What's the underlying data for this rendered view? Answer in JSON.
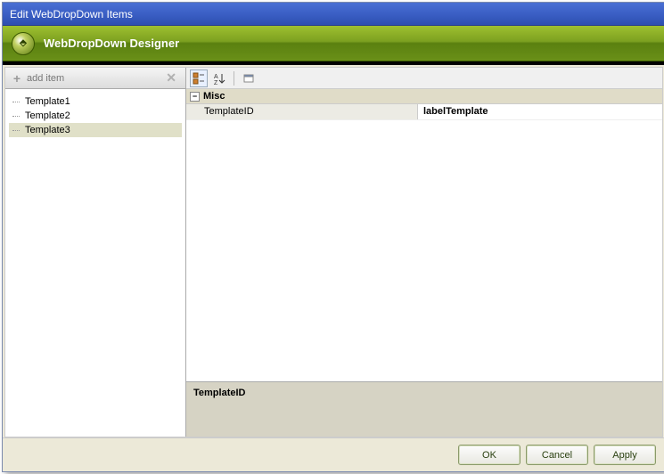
{
  "window": {
    "title": "Edit WebDropDown Items"
  },
  "designer": {
    "title": "WebDropDown Designer"
  },
  "sidebar": {
    "addItemLabel": "add item",
    "items": [
      {
        "label": "Template1"
      },
      {
        "label": "Template2"
      },
      {
        "label": "Template3"
      }
    ],
    "selectedIndex": 2
  },
  "propGrid": {
    "category": "Misc",
    "rows": [
      {
        "name": "TemplateID",
        "value": "labelTemplate"
      }
    ],
    "description": {
      "title": "TemplateID"
    }
  },
  "buttons": {
    "ok": "OK",
    "cancel": "Cancel",
    "apply": "Apply"
  }
}
